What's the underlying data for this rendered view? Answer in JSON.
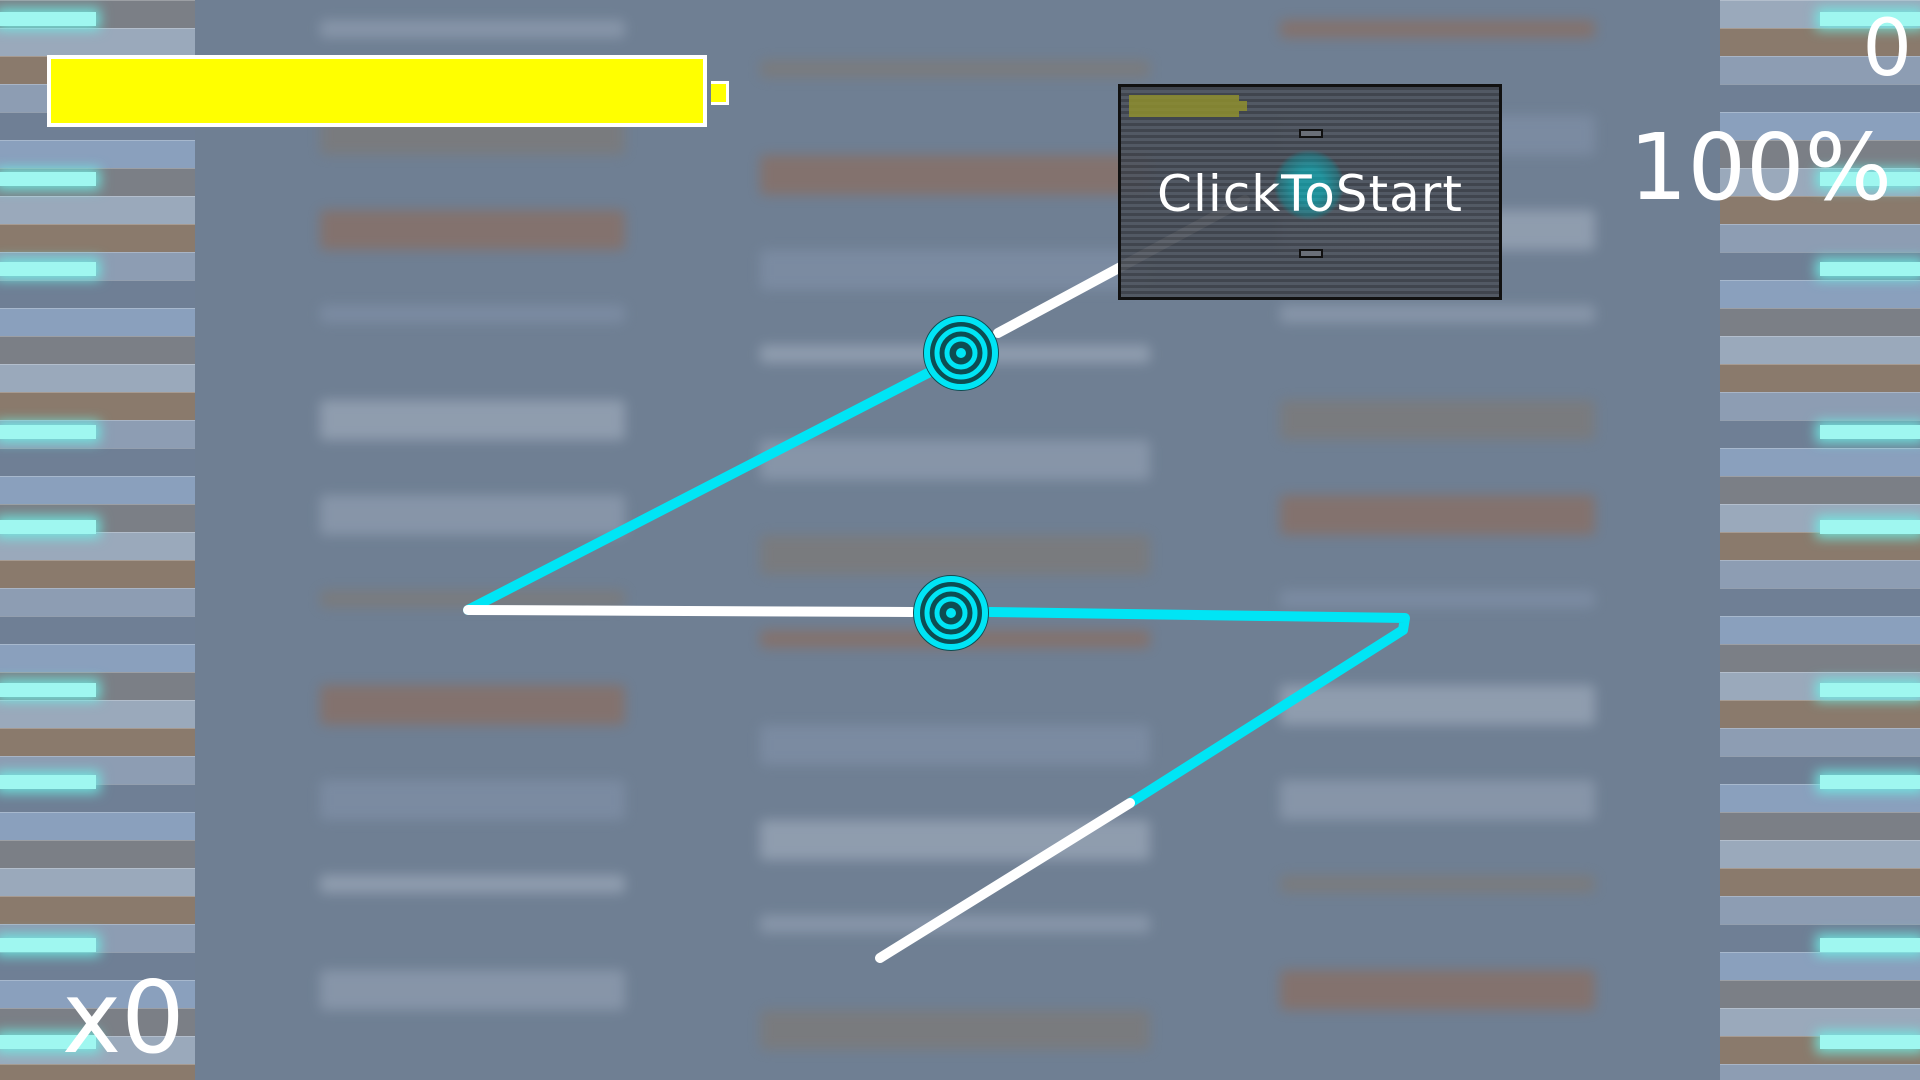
{
  "hud": {
    "score": "0",
    "accuracy": "100%",
    "combo": "x0",
    "health_fraction": 1.0
  },
  "start_overlay": {
    "label": "ClickToStart"
  },
  "colors": {
    "accent_cyan": "#00e5f5",
    "health_yellow": "#ffff00",
    "path_white": "#ffffff"
  }
}
